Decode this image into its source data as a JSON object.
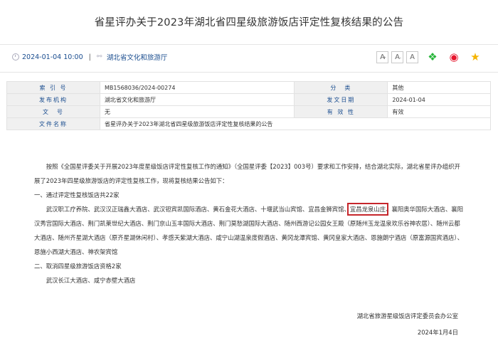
{
  "title": "省星评办关于2023年湖北省四星级旅游饭店评定性复核结果的公告",
  "meta": {
    "datetime": "2024-01-04 10:00",
    "separator": "|",
    "source": "湖北省文化和旅游厅",
    "font_buttons": [
      "A",
      "A",
      "A"
    ],
    "share_icons": [
      "wechat-icon",
      "weibo-icon",
      "favorite-icon"
    ]
  },
  "info_table": {
    "rows": [
      {
        "k1": "索 引 号",
        "v1": "MB1568036/2024-00274",
        "k2": "分　类",
        "v2": "其他"
      },
      {
        "k1": "发布机构",
        "v1": "湖北省文化和旅游厅",
        "k2": "发文日期",
        "v2": "2024-01-04"
      },
      {
        "k1": "文　号",
        "v1": "无",
        "k2": "有 效 性",
        "v2": "有效"
      },
      {
        "k1": "文件名称",
        "v1": "省星评办关于2023年湖北省四星级旅游饭店评定性复核结果的公告"
      }
    ]
  },
  "body": {
    "intro": "按照《全国星评委关于开展2023年度星级饭店评定性复核工作的通知》（全国星评委【2023】003号）要求和工作安排，结合湖北实际，湖北省星评办组织开展了2023年四星级旅游饭店的评定性复核工作，现将复核结果公告如下：",
    "section1_heading": "一、通过评定性复核饭店共22家",
    "section1_pre": "武汉职工疗养院、武汉汉正瑞鑫大酒店、武汉钽宾凯国际酒店、黄石金花大酒店、十堰武当山宾馆、宜昌金狮宾馆、",
    "section1_highlight": "宜昌龙泉山庄",
    "section1_post": "、襄阳奥华国际大酒店、襄阳汉秀宫国际大酒店、荆门凯莱世纪大酒店、荆门京山玉丰国际大酒店、荆门莫愁湖国际大酒店、随州西游记公园女王殿（原随州玉龙温泉欢乐谷神农居）、随州云都大酒店、随州齐星湖大酒店（原齐星湖休闲村）、孝感天紫湖大酒店、咸宁山湖温泉度假酒店、黄冈龙潭宾馆、黄冈皇家大酒店、恩施朗宁酒店（原富源国宾酒店）、恩施小西湖大酒店、神农架宾馆",
    "section2_heading": "二、取消四星级旅游饭店资格2家",
    "section2_text": "武汉长江大酒店、咸宁赤壁大酒店"
  },
  "signature": {
    "org": "湖北省旅游星级饭店评定委员会办公室",
    "date": "2024年1月4日"
  },
  "colors": {
    "link_blue": "#1a4d8f",
    "highlight_red": "#c6262b",
    "table_label_bg": "#f0f0f0"
  }
}
